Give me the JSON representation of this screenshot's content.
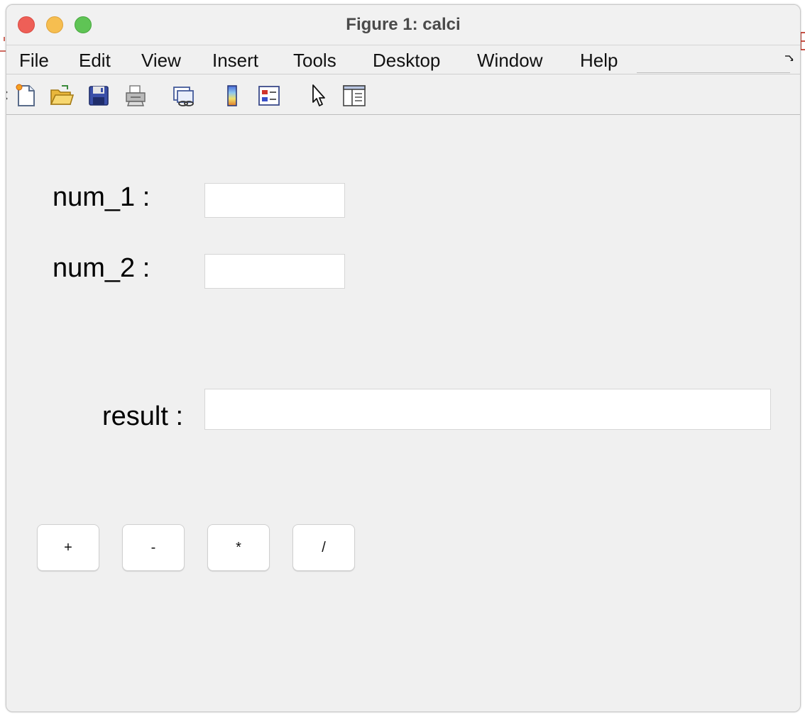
{
  "window": {
    "title": "Figure 1: calci"
  },
  "menubar": {
    "items": [
      "File",
      "Edit",
      "View",
      "Insert",
      "Tools",
      "Desktop",
      "Window",
      "Help"
    ]
  },
  "toolbar": {
    "icons": [
      "new-figure-icon",
      "open-file-icon",
      "save-icon",
      "print-icon",
      "link-plot-icon",
      "colorbar-icon",
      "legend-icon",
      "edit-plot-pointer-icon",
      "property-inspector-icon"
    ]
  },
  "form": {
    "num1_label": "num_1 :",
    "num1_value": "",
    "num2_label": "num_2 :",
    "num2_value": "",
    "result_label": "result :",
    "result_value": ""
  },
  "buttons": {
    "add": "+",
    "subtract": "-",
    "multiply": "*",
    "divide": "/"
  },
  "colors": {
    "close": "#ee5f57",
    "minimize": "#f6be50",
    "zoom": "#5fc455",
    "window_bg": "#f0f0f0"
  }
}
